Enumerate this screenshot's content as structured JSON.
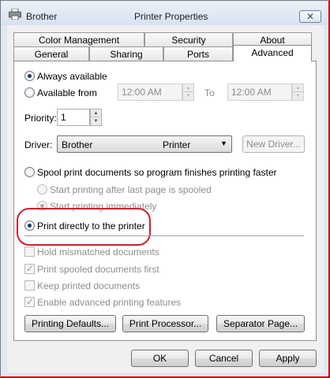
{
  "window": {
    "printer_name": "Brother",
    "title": "Printer Properties",
    "close_label": "✕"
  },
  "tabs_top": [
    "Color Management",
    "Security",
    "About"
  ],
  "tabs_bottom": [
    "General",
    "Sharing",
    "Ports",
    "Advanced"
  ],
  "availability": {
    "always_label": "Always available",
    "from_label": "Available from",
    "from_time": "12:00 AM",
    "to_label": "To",
    "to_time": "12:00 AM"
  },
  "priority": {
    "label": "Priority:",
    "value": "1"
  },
  "driver": {
    "label": "Driver:",
    "name": "Brother",
    "type": "Printer",
    "new_driver_label": "New Driver..."
  },
  "spooling": {
    "spool_label": "Spool print documents so program finishes printing faster",
    "after_last_page_label": "Start printing after last page is spooled",
    "immediately_label": "Start printing immediately",
    "direct_label": "Print directly to the printer"
  },
  "options": {
    "hold_label": "Hold mismatched documents",
    "spooled_first_label": "Print spooled documents first",
    "keep_label": "Keep printed documents",
    "advanced_features_label": "Enable advanced printing features"
  },
  "panel_buttons": {
    "defaults_label": "Printing Defaults...",
    "processor_label": "Print Processor...",
    "separator_label": "Separator Page..."
  },
  "dialog_buttons": {
    "ok_label": "OK",
    "cancel_label": "Cancel",
    "apply_label": "Apply"
  }
}
